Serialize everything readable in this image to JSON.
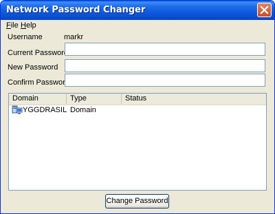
{
  "window": {
    "title": "Network Password Changer"
  },
  "menu": [
    {
      "label": "File",
      "accel": "F",
      "rest": "ile"
    },
    {
      "label": "Help",
      "accel": "H",
      "rest": "elp"
    }
  ],
  "form": {
    "username_label": "Username",
    "username_value": "markr",
    "current_password_label": "Current Password",
    "new_password_label": "New Password",
    "confirm_password_label": "Confirm Password",
    "current_password_value": "",
    "new_password_value": "",
    "confirm_password_value": ""
  },
  "list": {
    "columns": [
      "Domain",
      "Type",
      "Status"
    ],
    "rows": [
      {
        "domain": "YGGDRASIL",
        "type": "Domain",
        "status": "",
        "icon": "server-icon"
      }
    ]
  },
  "actions": {
    "change_password_label": "Change Password"
  }
}
